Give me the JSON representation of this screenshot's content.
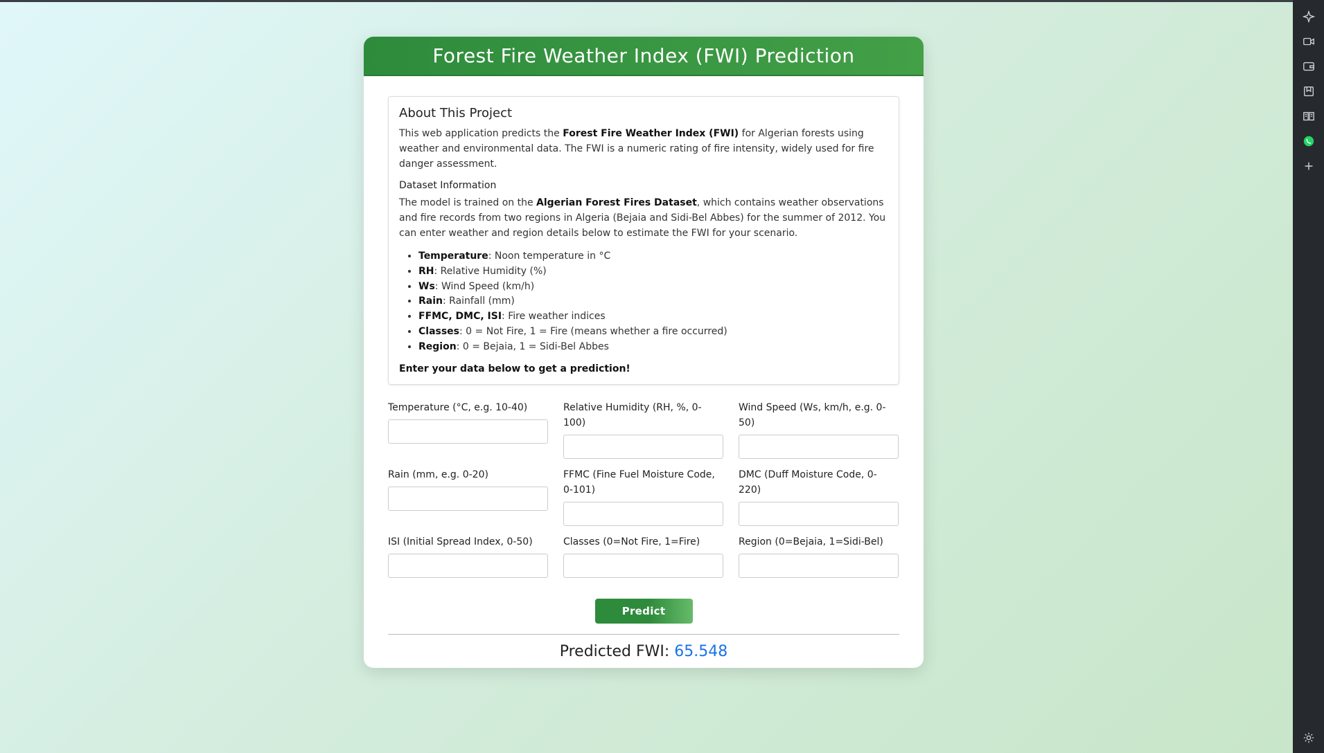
{
  "header": {
    "title": "Forest Fire Weather Index (FWI) Prediction"
  },
  "about": {
    "title": "About This Project",
    "intro_1": "This web application predicts the ",
    "intro_bold": "Forest Fire Weather Index (FWI)",
    "intro_2": " for Algerian forests using weather and environmental data. The FWI is a numeric rating of fire intensity, widely used for fire danger assessment.",
    "dataset_title": "Dataset Information",
    "dataset_1": "The model is trained on the ",
    "dataset_bold": "Algerian Forest Fires Dataset",
    "dataset_2": ", which contains weather observations and fire records from two regions in Algeria (Bejaia and Sidi-Bel Abbes) for the summer of 2012. You can enter weather and region details below to estimate the FWI for your scenario.",
    "features": [
      {
        "name": "Temperature",
        "desc": ": Noon temperature in °C"
      },
      {
        "name": "RH",
        "desc": ": Relative Humidity (%)"
      },
      {
        "name": "Ws",
        "desc": ": Wind Speed (km/h)"
      },
      {
        "name": "Rain",
        "desc": ": Rainfall (mm)"
      },
      {
        "name": "FFMC, DMC, ISI",
        "desc": ": Fire weather indices"
      },
      {
        "name": "Classes",
        "desc": ": 0 = Not Fire, 1 = Fire (means whether a fire occurred)"
      },
      {
        "name": "Region",
        "desc": ": 0 = Bejaia, 1 = Sidi-Bel Abbes"
      }
    ],
    "cta": "Enter your data below to get a prediction!"
  },
  "form": {
    "fields": [
      {
        "label": "Temperature (°C, e.g. 10-40)",
        "value": ""
      },
      {
        "label": "Relative Humidity (RH, %, 0-100)",
        "value": ""
      },
      {
        "label": "Wind Speed (Ws, km/h, e.g. 0-50)",
        "value": ""
      },
      {
        "label": "Rain (mm, e.g. 0-20)",
        "value": ""
      },
      {
        "label": "FFMC (Fine Fuel Moisture Code, 0-101)",
        "value": ""
      },
      {
        "label": "DMC (Duff Moisture Code, 0-220)",
        "value": ""
      },
      {
        "label": "ISI (Initial Spread Index, 0-50)",
        "value": ""
      },
      {
        "label": "Classes (0=Not Fire, 1=Fire)",
        "value": ""
      },
      {
        "label": "Region (0=Bejaia, 1=Sidi-Bel)",
        "value": ""
      }
    ],
    "submit_label": "Predict"
  },
  "result": {
    "label": "Predicted FWI: ",
    "value": "65.548"
  },
  "sidebar_icons": [
    "sparkle-icon",
    "video-icon",
    "wallet-icon",
    "bookmark-icon",
    "reader-icon",
    "whatsapp-icon",
    "plus-icon",
    "settings-icon"
  ],
  "colors": {
    "header": "#2e8b3c",
    "accent": "#1a73e8",
    "button": "#43a047"
  }
}
